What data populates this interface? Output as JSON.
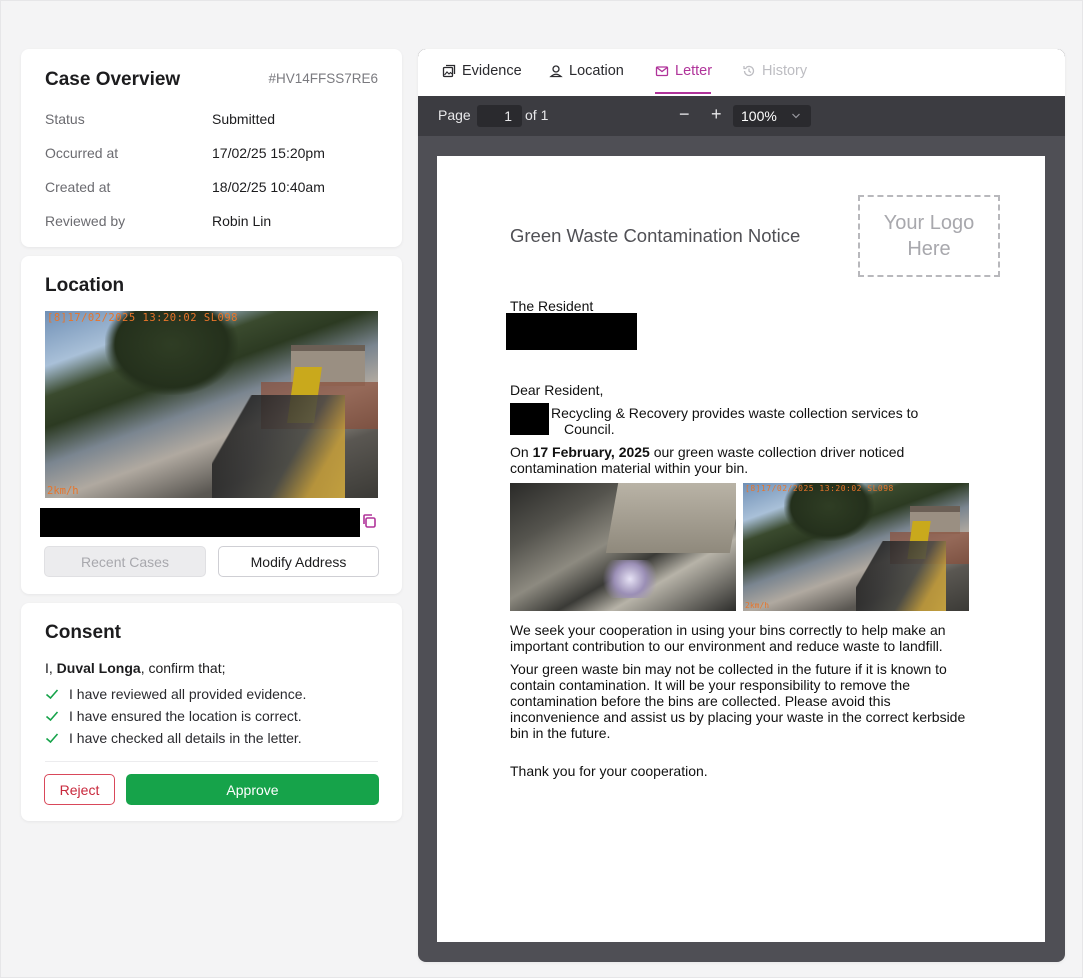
{
  "overview": {
    "title": "Case Overview",
    "case_id": "#HV14FFSS7RE6",
    "rows": [
      {
        "label": "Status",
        "value": "Submitted"
      },
      {
        "label": "Occurred at",
        "value": "17/02/25 15:20pm"
      },
      {
        "label": "Created at",
        "value": "18/02/25 10:40am"
      },
      {
        "label": "Reviewed by",
        "value": "Robin Lin"
      }
    ]
  },
  "location": {
    "title": "Location",
    "photo_stamp": "[8]17/02/2025 13:20:02  SL098",
    "photo_speed": "2km/h",
    "recent_cases_label": "Recent Cases",
    "modify_address_label": "Modify Address"
  },
  "consent": {
    "title": "Consent",
    "intro_prefix": "I, ",
    "name": "Duval Longa",
    "intro_suffix": ", confirm that;",
    "checks": [
      "I have reviewed all provided evidence.",
      "I have ensured the location is correct.",
      "I have checked all details in the letter."
    ],
    "reject_label": "Reject",
    "approve_label": "Approve"
  },
  "tabs": [
    {
      "label": "Evidence",
      "icon": "image-icon",
      "state": "normal"
    },
    {
      "label": "Location",
      "icon": "pin-icon",
      "state": "normal"
    },
    {
      "label": "Letter",
      "icon": "mail-icon",
      "state": "active"
    },
    {
      "label": "History",
      "icon": "history-icon",
      "state": "disabled"
    }
  ],
  "toolbar": {
    "page_label": "Page",
    "page_value": "1",
    "page_of": "of 1",
    "zoom_out": "−",
    "zoom_in": "+",
    "zoom_value": "100%"
  },
  "letter": {
    "title": "Green Waste Contamination Notice",
    "logo_text": "Your Logo Here",
    "recipient": "The Resident",
    "salutation": "Dear Resident,",
    "intro_line1": "Recycling & Recovery provides waste collection services to",
    "intro_line2": "Council.",
    "on_prefix": "On ",
    "date": "17 February, 2025",
    "on_suffix": " our green waste collection driver noticed contamination material within your bin.",
    "evidence_stamp_2": "[8]17/02/2025 13:20:02  SL098",
    "evidence_speed_2": "2km/h",
    "para1": "We seek your cooperation in using your bins correctly to help make an important contribution to our environment and reduce waste to landfill.",
    "para2": "Your green waste bin may not be collected in the future if it is known to contain contamination. It will be your responsibility to remove the contamination before the bins are collected. Please avoid this inconvenience and assist us by placing your waste in the correct kerbside bin in the future.",
    "closing": "Thank you for your cooperation."
  },
  "colors": {
    "accent": "#b0339a",
    "approve": "#16a34a",
    "reject": "#c8283c",
    "viewer_bg": "#4f4f55"
  }
}
